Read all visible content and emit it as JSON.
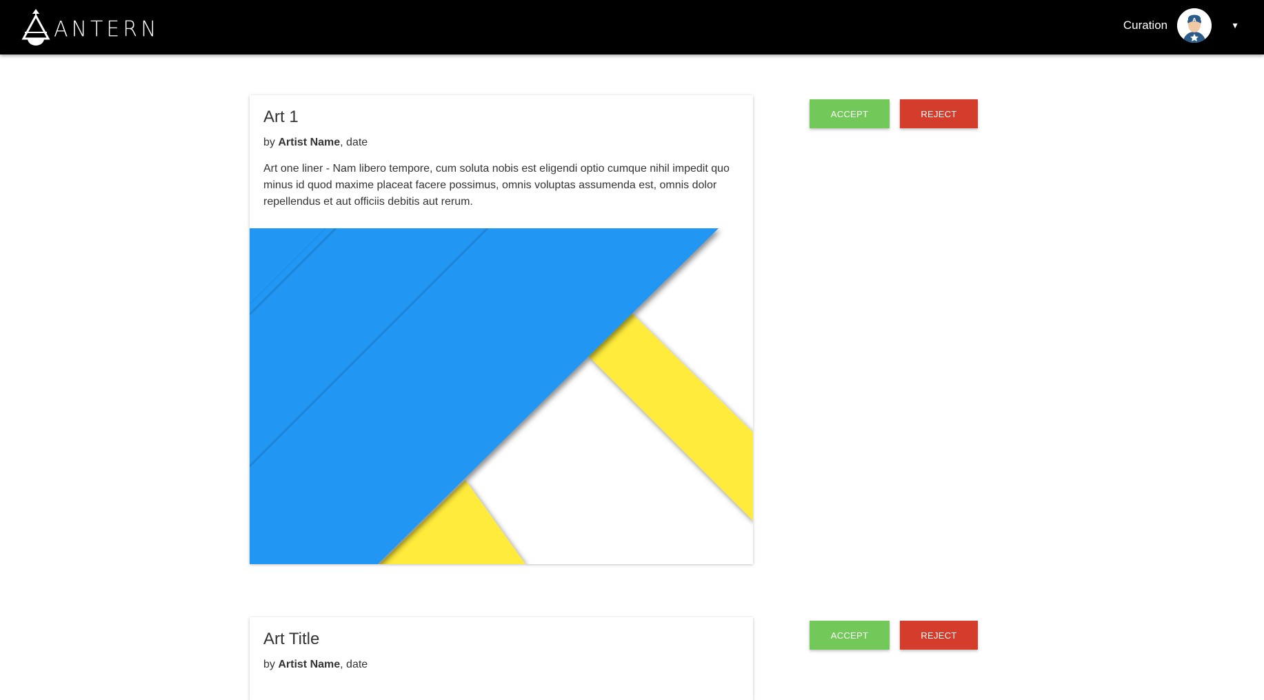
{
  "header": {
    "brand_name": "ANTERN",
    "nav_link": "Curation",
    "avatar_icon": "superhero-avatar-icon",
    "menu_icon": "caret-down-icon"
  },
  "artworks": [
    {
      "title": "Art 1",
      "by_prefix": "by ",
      "artist": "Artist Name",
      "date_suffix": ", date",
      "description": "Art one liner - Nam libero tempore, cum soluta nobis est eligendi optio cumque nihil impedit quo minus id quod maxime placeat facere possimus, omnis voluptas assumenda est, omnis dolor repellendus et aut officiis debitis aut rerum.",
      "accept_label": "ACCEPT",
      "reject_label": "REJECT"
    },
    {
      "title": "Art Title",
      "by_prefix": "by ",
      "artist": "Artist Name",
      "date_suffix": ", date",
      "accept_label": "ACCEPT",
      "reject_label": "REJECT"
    }
  ],
  "colors": {
    "accept": "#72c95a",
    "reject": "#d43c2b",
    "art_blue": "#2196f3",
    "art_yellow": "#ffeb3b"
  }
}
